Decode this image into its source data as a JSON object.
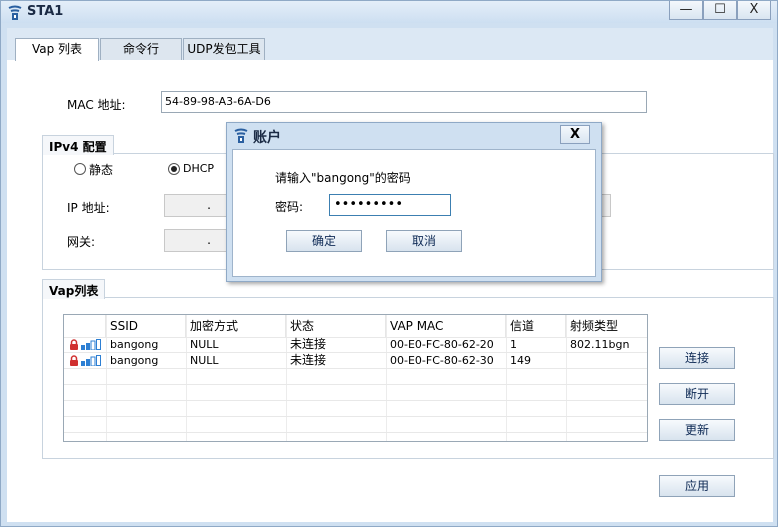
{
  "window": {
    "title": "STA1",
    "minimize": "—",
    "maximize": "☐",
    "close": "X"
  },
  "tabs": [
    {
      "label": "Vap 列表"
    },
    {
      "label": "命令行"
    },
    {
      "label": "UDP发包工具"
    }
  ],
  "mac": {
    "label": "MAC 地址:",
    "value": "54-89-98-A3-6A-D6"
  },
  "ipv4": {
    "group_title": "IPv4 配置",
    "static_label": "静态",
    "dhcp_label": "DHCP",
    "selected": "DHCP",
    "ip_label": "IP 地址:",
    "gateway_label": "网关:",
    "ip_value": ".",
    "gateway_value": "."
  },
  "vap": {
    "group_title": "Vap列表",
    "columns": [
      "",
      "SSID",
      "加密方式",
      "状态",
      "VAP MAC",
      "信道",
      "射频类型"
    ],
    "rows": [
      {
        "ssid": "bangong",
        "encryption": "NULL",
        "status": "未连接",
        "vap_mac": "00-E0-FC-80-62-20",
        "channel": "1",
        "radio": "802.11bgn"
      },
      {
        "ssid": "bangong",
        "encryption": "NULL",
        "status": "未连接",
        "vap_mac": "00-E0-FC-80-62-30",
        "channel": "149",
        "radio": ""
      }
    ]
  },
  "buttons": {
    "connect": "连接",
    "disconnect": "断开",
    "refresh": "更新",
    "apply": "应用"
  },
  "dialog": {
    "title": "账户",
    "close": "X",
    "prompt": "请输入\"bangong\"的密码",
    "password_label": "密码:",
    "password_value": "•••••••••",
    "ok": "确定",
    "cancel": "取消"
  },
  "colors": {
    "window_frame": "#cfe0f1",
    "accent": "#3c7fb1",
    "lock": "#d03030",
    "signal": "#2d7fd3"
  }
}
